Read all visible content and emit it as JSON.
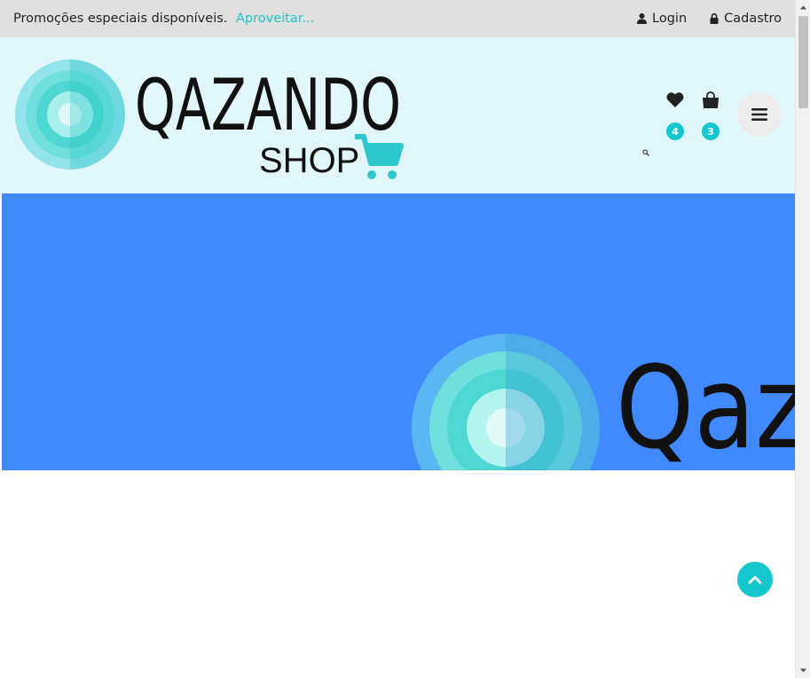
{
  "topbar": {
    "promo_text": "Promoções especiais disponíveis.",
    "promo_link": "Aproveitar...",
    "login_label": "Login",
    "signup_label": "Cadastro"
  },
  "header": {
    "logo_word": "QAZANDO",
    "logo_sub": "SHOP",
    "wishlist_count": "4",
    "cart_count": "3",
    "icons": [
      "search-icon",
      "heart-icon",
      "shopping-bag-icon",
      "hamburger-menu-icon"
    ]
  },
  "banner": {
    "logo_word_partial": "Qaz"
  },
  "colors": {
    "accent": "#14c7cc",
    "topbar_bg": "#e0e0e0",
    "header_bg": "#e2f7fb",
    "banner_bg": "#4189ff"
  }
}
